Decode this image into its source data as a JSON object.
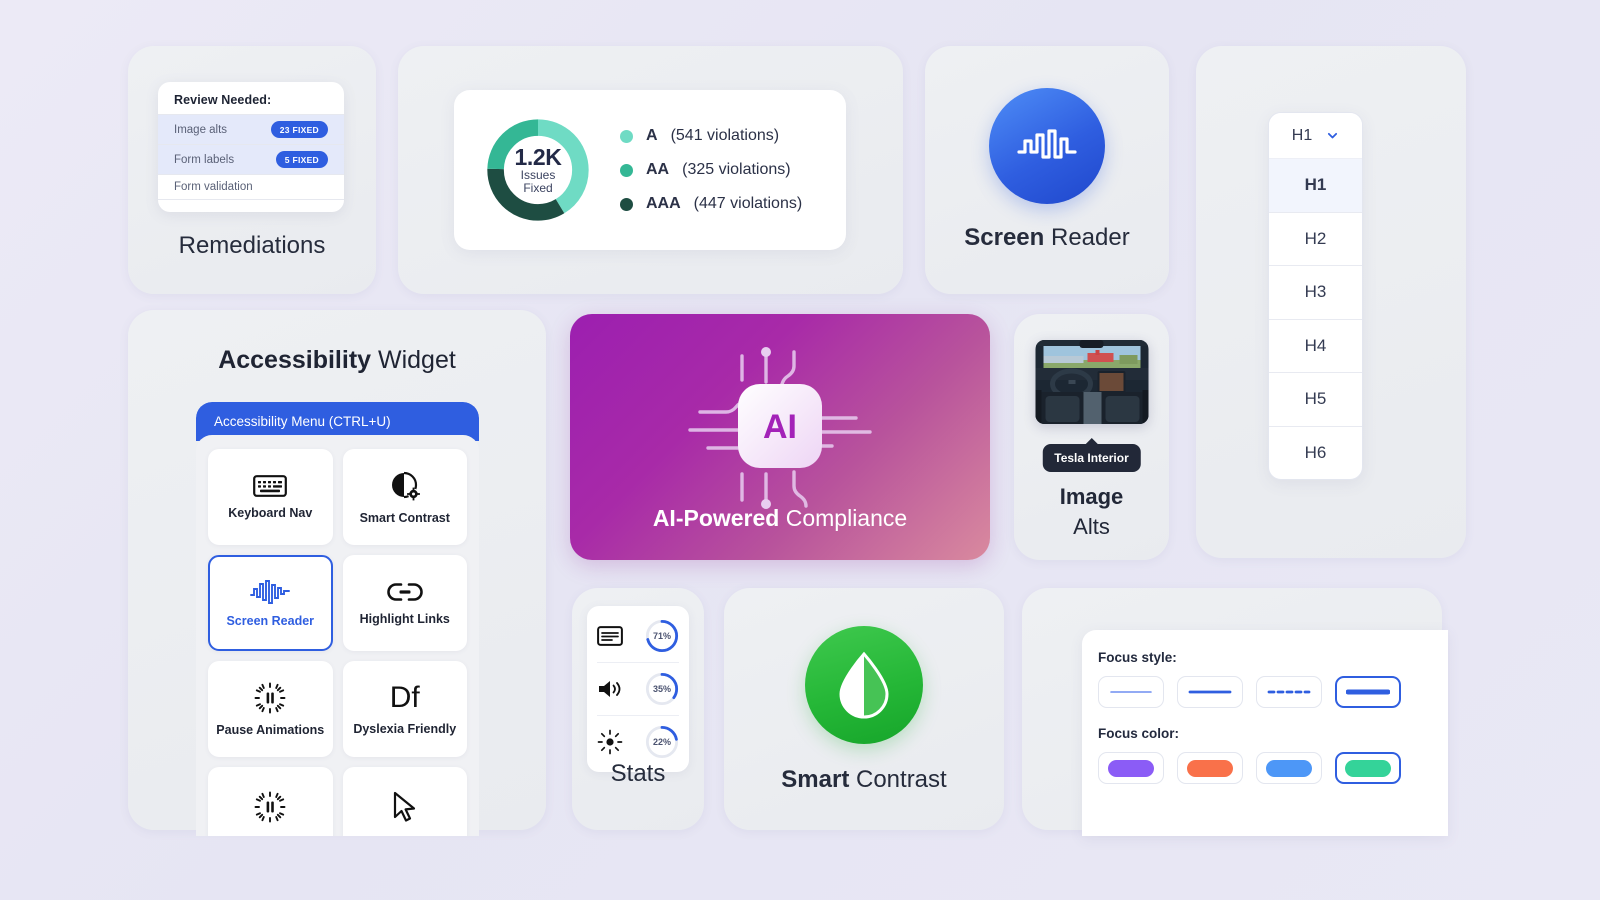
{
  "background": {
    "accent_blue": "#2f5ee0"
  },
  "remediations": {
    "panel_title": "Review Needed:",
    "rows": [
      {
        "label": "Image alts",
        "badge": "23 FIXED",
        "highlighted": true
      },
      {
        "label": "Form labels",
        "badge": "5 FIXED",
        "highlighted": true
      },
      {
        "label": "Form validation",
        "badge": "",
        "highlighted": false
      }
    ],
    "caption": "Remediations"
  },
  "scorecard": {
    "center_value": "1.2K",
    "center_line1": "Issues",
    "center_line2": "Fixed",
    "legend": [
      {
        "level": "A",
        "text": "(541 violations)",
        "color": "#6FDBC4"
      },
      {
        "level": "AA",
        "text": "(325 violations)",
        "color": "#34B795"
      },
      {
        "level": "AAA",
        "text": "(447 violations)",
        "color": "#1E4D42"
      }
    ]
  },
  "chart_data": {
    "type": "pie",
    "title": "Issues Fixed",
    "categories": [
      "A",
      "AAA",
      "AA"
    ],
    "values": [
      541,
      447,
      325
    ],
    "colors": [
      "#6FDBC4",
      "#1E4D42",
      "#34B795"
    ],
    "center_label": "1.2K Issues Fixed",
    "total": 1313,
    "legend_position": "right"
  },
  "screen_reader": {
    "icon": "waveform-icon",
    "caption_bold": "Screen",
    "caption_rest": " Reader"
  },
  "headings": {
    "selected": "H1",
    "chevron": "chevron-down-icon",
    "options": [
      "H1",
      "H2",
      "H3",
      "H4",
      "H5",
      "H6"
    ],
    "active_index": 0
  },
  "widget": {
    "title_bold": "Accessibility",
    "title_rest": " Widget",
    "menu_bar": "Accessibility Menu (CTRL+U)",
    "tiles": [
      {
        "label": "Keyboard Nav",
        "icon": "keyboard-icon",
        "selected": false
      },
      {
        "label": "Smart Contrast",
        "icon": "contrast-gear-icon",
        "selected": false
      },
      {
        "label": "Screen Reader",
        "icon": "waveform-icon",
        "selected": true
      },
      {
        "label": "Highlight Links",
        "icon": "link-chain-icon",
        "selected": false
      },
      {
        "label": "Pause Animations",
        "icon": "pause-burst-icon",
        "selected": false
      },
      {
        "label": "Dyslexia Friendly",
        "icon": "df-text-icon",
        "selected": false
      },
      {
        "label": "",
        "icon": "pause-burst-icon",
        "selected": false
      },
      {
        "label": "",
        "icon": "cursor-arrow-icon",
        "selected": false
      }
    ]
  },
  "ai": {
    "chip_text": "AI",
    "caption_bold": "AI-Powered",
    "caption_rest": " Compliance"
  },
  "image_alts": {
    "thumbnail_alt": "Tesla car interior with steering wheel and touchscreen",
    "tooltip": "Tesla Interior",
    "caption_bold": "Image",
    "caption_rest": "Alts"
  },
  "stats": {
    "rows": [
      {
        "icon": "captions-icon",
        "percent": 71,
        "label": "71%"
      },
      {
        "icon": "speaker-icon",
        "percent": 35,
        "label": "35%"
      },
      {
        "icon": "brightness-icon",
        "percent": 22,
        "label": "22%"
      }
    ],
    "caption": "Stats"
  },
  "smart_contrast": {
    "icon": "droplet-contrast-icon",
    "caption_bold": "Smart",
    "caption_rest": " Contrast"
  },
  "focus": {
    "style_label": "Focus style:",
    "styles": [
      {
        "name": "thin-underline",
        "selected": false
      },
      {
        "name": "medium-underline",
        "selected": false
      },
      {
        "name": "dashed-underline",
        "selected": false
      },
      {
        "name": "thick-underline",
        "selected": true
      }
    ],
    "color_label": "Focus color:",
    "colors": [
      {
        "hex": "#8b5cf6",
        "selected": false
      },
      {
        "hex": "#f9714a",
        "selected": false
      },
      {
        "hex": "#4d97f7",
        "selected": false
      },
      {
        "hex": "#34d399",
        "selected": true
      }
    ]
  }
}
